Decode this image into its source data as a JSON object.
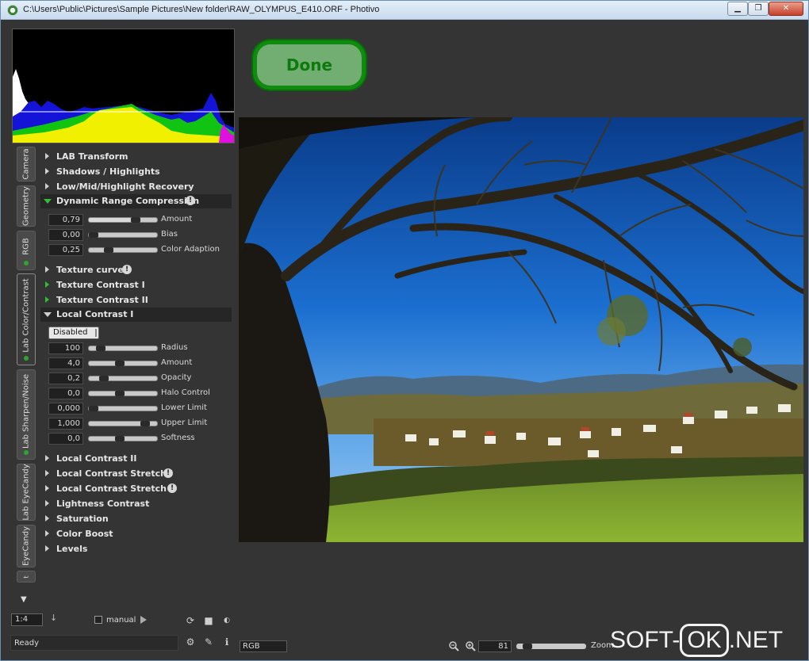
{
  "window": {
    "title": "C:\\Users\\Public\\Pictures\\Sample Pictures\\New folder\\RAW_OLYMPUS_E410.ORF - Photivo",
    "minimize": "▁",
    "maximize": "❐",
    "close": "✕"
  },
  "vertical_tabs": [
    {
      "label": "Camera"
    },
    {
      "label": "Geometry"
    },
    {
      "label": "RGB"
    },
    {
      "label": "Lab Color/Contrast"
    },
    {
      "label": "Lab Sharpen/Noise"
    },
    {
      "label": "Lab EyeCandy"
    },
    {
      "label": "EyeCandy"
    },
    {
      "label": "t"
    }
  ],
  "panel": {
    "sections": {
      "lab_transform": "LAB Transform",
      "shadows_highlights": "Shadows / Highlights",
      "lowmidhigh": "Low/Mid/Highlight Recovery",
      "drc": "Dynamic Range Compression",
      "texture_curve": "Texture curve",
      "texture_contrast_1": "Texture Contrast I",
      "texture_contrast_2": "Texture Contrast II",
      "local_contrast_1": "Local Contrast I",
      "local_contrast_2": "Local Contrast II",
      "lcs1": "Local Contrast Stretch I",
      "lcs2": "Local Contrast Stretch II",
      "lightness_contrast": "Lightness Contrast",
      "saturation": "Saturation",
      "color_boost": "Color Boost",
      "levels": "Levels"
    },
    "drc_sliders": [
      {
        "value": "0,79",
        "name": "Amount",
        "level": 0.72
      },
      {
        "value": "0,00",
        "name": "Bias",
        "level": 0.0
      },
      {
        "value": "0,25",
        "name": "Color Adaption",
        "level": 0.25
      }
    ],
    "lc1_mode": "Disabled",
    "lc1_sliders": [
      {
        "value": "100",
        "name": "Radius",
        "level": 0.12
      },
      {
        "value": "4,0",
        "name": "Amount",
        "level": 0.45
      },
      {
        "value": "0,2",
        "name": "Opacity",
        "level": 0.18
      },
      {
        "value": "0,0",
        "name": "Halo Control",
        "level": 0.45
      },
      {
        "value": "0,000",
        "name": "Lower Limit",
        "level": 0.0
      },
      {
        "value": "1,000",
        "name": "Upper Limit",
        "level": 0.88
      },
      {
        "value": "0,0",
        "name": "Softness",
        "level": 0.45
      }
    ]
  },
  "bottom_left": {
    "zoom_ratio": "1:4",
    "manual_label": "manual",
    "status": "Ready"
  },
  "done_label": "Done",
  "bottom_right": {
    "mode": "RGB",
    "zoom_value": "81",
    "zoom_level": 0.1,
    "zoom_label": "Zoom"
  },
  "watermark": {
    "left": "SOFT-",
    "box": "OK",
    "right": ".NET"
  },
  "colors": {
    "done_green": "#0f8c0f",
    "active_dot": "#2fa52f"
  }
}
